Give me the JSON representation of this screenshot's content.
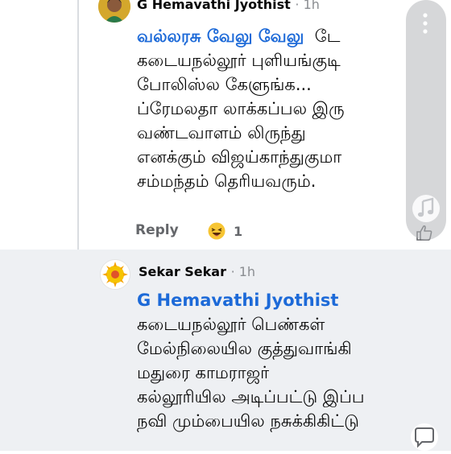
{
  "comments": [
    {
      "author": "G Hemavathi Jyothist",
      "time": "· 1h",
      "mention": "வல்லரசு வேலு வேலு",
      "lines": [
        "டே",
        "கடையநல்லூர் புளியங்குடி",
        "போலிஸ்ல கேளுங்க...",
        "ப்ரேமலதா லாக்கப்பல இரு",
        "வண்டவாளம் லிருந்து",
        "எனக்கும் விஜய்காந்துகுமா",
        "சம்மந்தம் தெரியவரும்."
      ],
      "reply_label": "Reply",
      "reaction_count": "1"
    },
    {
      "author": "Sekar Sekar",
      "time": "· 1h",
      "mention": "G Hemavathi Jyothist",
      "lines": [
        "கடையநல்லூர் பெண்கள்",
        "மேல்நிலையில குத்துவாங்கி",
        "மதுரை காமராஜர்",
        "கல்லூரியில அடிப்பட்டு இப்ப",
        "நவி மும்பையில நசுக்கிகிட்டு"
      ]
    }
  ],
  "icons": {
    "reaction": "laughing-emoji-icon",
    "like": "thumbs-up-icon",
    "menu": "vertical-dots-icon",
    "audio": "music-note-icon",
    "comment": "comment-icon"
  },
  "colors": {
    "mention": "#1d6ad8",
    "highlight_bg": "#eef0f3"
  }
}
